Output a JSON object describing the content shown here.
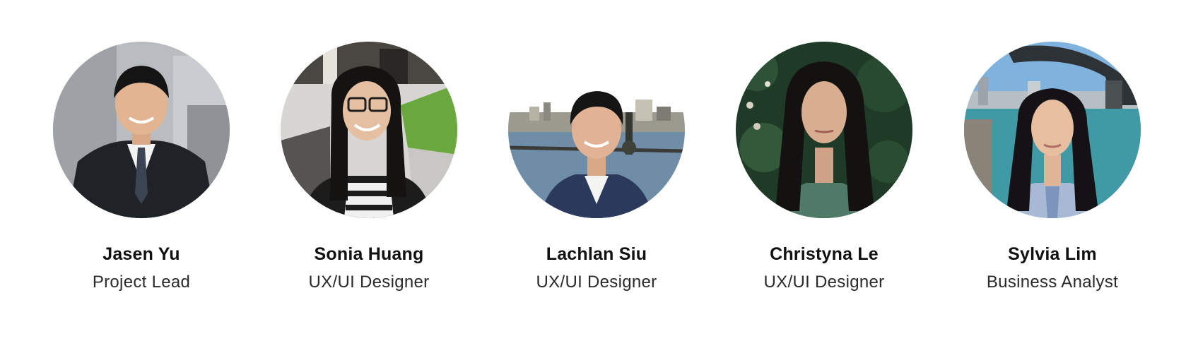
{
  "team": {
    "members": [
      {
        "name": "Jasen Yu",
        "role": "Project Lead"
      },
      {
        "name": "Sonia Huang",
        "role": "UX/UI Designer"
      },
      {
        "name": "Lachlan Siu",
        "role": "UX/UI Designer"
      },
      {
        "name": "Christyna Le",
        "role": "UX/UI Designer"
      },
      {
        "name": "Sylvia Lim",
        "role": "Business Analyst"
      }
    ]
  },
  "colors": {
    "background": "#ffffff",
    "name_text": "#111111",
    "role_text": "#2a2a2a"
  }
}
